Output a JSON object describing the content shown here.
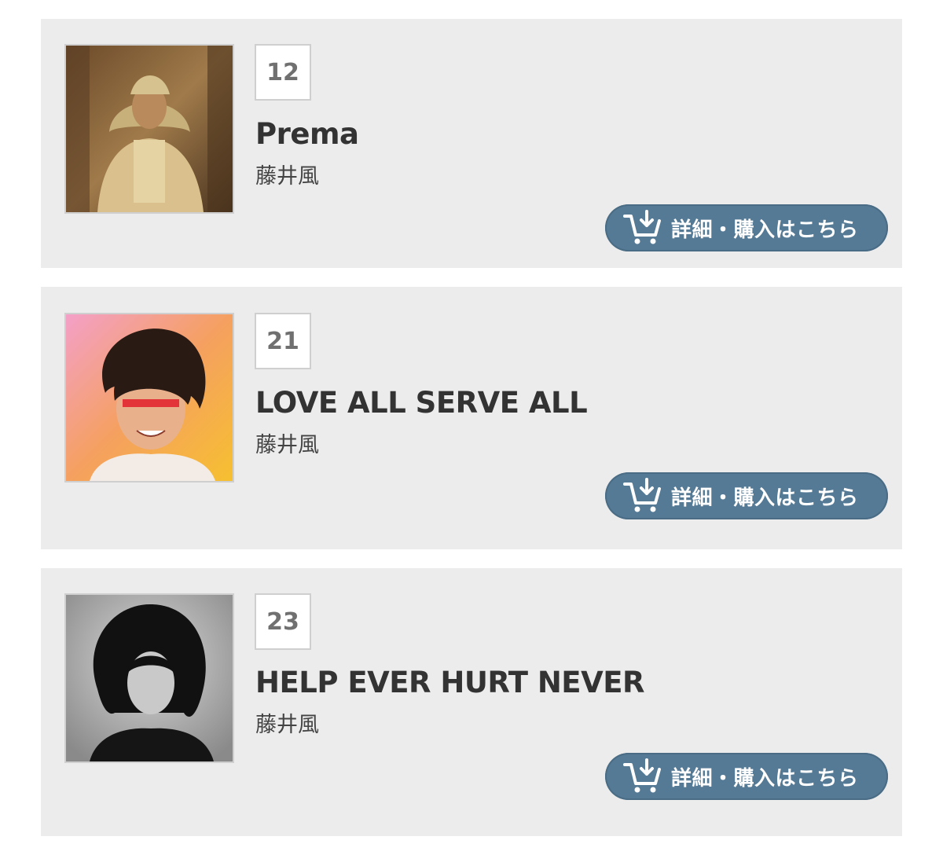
{
  "items": [
    {
      "rank": "12",
      "title": "Prema",
      "artist": "藤井風",
      "cover_icon": "album-cover-image",
      "button_label": "詳細・購入はこちら",
      "button_icon": "cart-download-icon"
    },
    {
      "rank": "21",
      "title": "LOVE ALL SERVE ALL",
      "artist": "藤井風",
      "cover_icon": "album-cover-image",
      "button_label": "詳細・購入はこちら",
      "button_icon": "cart-download-icon"
    },
    {
      "rank": "23",
      "title": "HELP EVER HURT NEVER",
      "artist": "藤井風",
      "cover_icon": "album-cover-image",
      "button_label": "詳細・購入はこちら",
      "button_icon": "cart-download-icon"
    }
  ],
  "colors": {
    "card_background": "#ececec",
    "button_background": "#557a95",
    "title_text": "#333333",
    "rank_text": "#707070"
  }
}
